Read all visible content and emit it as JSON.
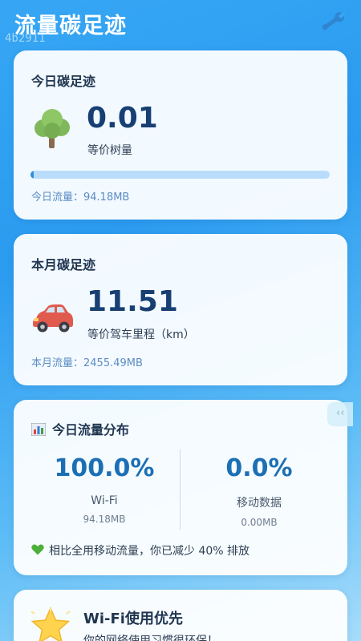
{
  "app": {
    "title": "流量碳足迹",
    "watermark": "4b2911",
    "settings_icon": "wrench-icon"
  },
  "today": {
    "title": "今日碳足迹",
    "value": "0.01",
    "equiv_label": "等价树量",
    "usage": "今日流量：94.18MB",
    "progress": 0.01,
    "icon": "tree-icon"
  },
  "month": {
    "title": "本月碳足迹",
    "value": "11.51",
    "equiv_label": "等价驾车里程（km）",
    "usage": "本月流量：2455.49MB",
    "icon": "car-icon"
  },
  "distribution": {
    "title": "今日流量分布",
    "icon": "bar-chart-icon",
    "wifi": {
      "percent": "100.0%",
      "label": "Wi-Fi",
      "size": "94.18MB"
    },
    "mobile": {
      "percent": "0.0%",
      "label": "移动数据",
      "size": "0.00MB"
    },
    "note": "相比全用移动流量，你已减少 40% 排放",
    "note_icon": "green-heart-icon"
  },
  "side_handle": {
    "label": "‹‹"
  },
  "wifi_tip": {
    "title": "Wi-Fi使用优先",
    "desc": "你的网络使用习惯很环保！",
    "icon": "star-icon"
  },
  "colors": {
    "accent": "#1c6fb4",
    "value": "#173f73",
    "progress": "#2f8de0",
    "note_heart": "#4caf3a"
  }
}
